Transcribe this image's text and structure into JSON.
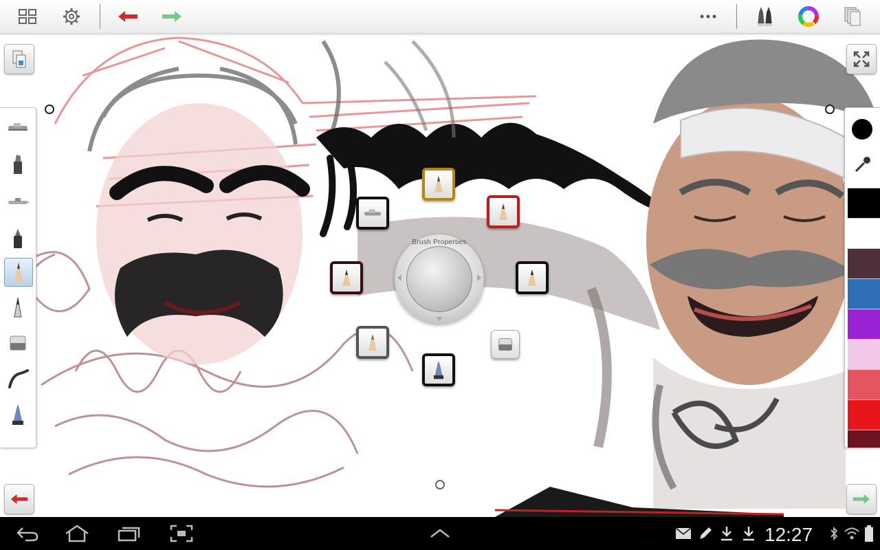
{
  "toolbar": {
    "icons": [
      "grid-icon",
      "gear-icon",
      "undo-icon",
      "redo-icon",
      "more-icon",
      "brushes-icon",
      "color-wheel-icon",
      "layers-icon"
    ]
  },
  "brush_menu": {
    "center_label": "Brush Properties"
  },
  "left_panel": {
    "brushes": [
      "airbrush",
      "marker",
      "airbrush-2",
      "felt-pen",
      "pencil",
      "ballpoint",
      "eraser",
      "smudge",
      "ink-pen"
    ],
    "active_index": 4
  },
  "color_panel": {
    "current_color": "#000000",
    "swatches": [
      "#000000",
      "#ffffff",
      "#4d3038",
      "#2f6fb5",
      "#9b23d6",
      "#f2c8e8",
      "#e55560",
      "#e8161b",
      "#6b1420"
    ]
  },
  "status_bar": {
    "time": "12:27",
    "icons": [
      "back-icon",
      "home-icon",
      "recent-apps-icon",
      "screenshot-icon",
      "up-chevron-icon",
      "gmail-icon",
      "pencil-notify-icon",
      "download-icon",
      "download-icon",
      "bluetooth-icon",
      "wifi-icon",
      "battery-icon"
    ]
  },
  "colors": {
    "accent_red": "#d02a2a",
    "accent_green": "#7bc68a",
    "gold_border": "#b8860b"
  }
}
